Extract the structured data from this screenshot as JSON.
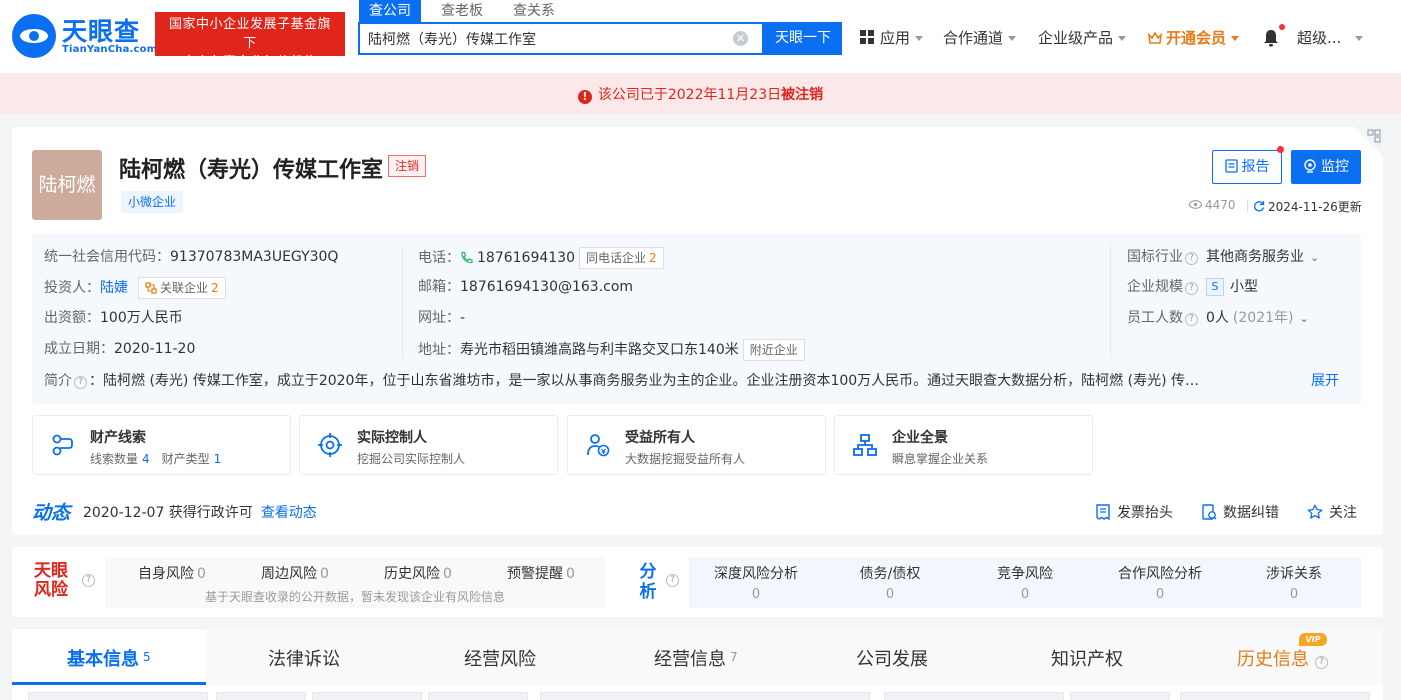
{
  "header": {
    "logo_text": "天眼查",
    "logo_sub": "TianYanCha.com",
    "gov_badge_line1": "国家中小企业发展子基金旗下",
    "gov_badge_line2": "官方备案企业征信机构",
    "search_tabs": [
      "查公司",
      "查老板",
      "查关系"
    ],
    "search_value": "陆柯燃（寿光）传媒工作室",
    "search_button": "天眼一下",
    "nav": {
      "apps": "应用",
      "channels": "合作通道",
      "enterprise": "企业级产品",
      "vip": "开通会员",
      "user": "超级..."
    }
  },
  "notice": {
    "prefix": "该公司已于2022年11月23日",
    "strong": "被注销"
  },
  "company": {
    "avatar_text": "陆柯燃",
    "name": "陆柯燃（寿光）传媒工作室",
    "status": "注销",
    "size_tag": "小微企业",
    "report_label": "报告",
    "monitor_label": "监控",
    "views": "4470",
    "updated": "2024-11-26更新"
  },
  "info": {
    "credit_code_label": "统一社会信用代码：",
    "credit_code": "91370783MA3UEGY30Q",
    "investor_label": "投资人：",
    "investor": "陆婕",
    "related_label": "关联企业",
    "related_count": "2",
    "capital_label": "出资额：",
    "capital": "100万人民币",
    "founded_label": "成立日期：",
    "founded": "2020-11-20",
    "phone_label": "电话：",
    "phone": "18761694130",
    "same_phone_label": "同电话企业",
    "same_phone_count": "2",
    "email_label": "邮箱：",
    "email": "18761694130@163.com",
    "website_label": "网址：",
    "website": "-",
    "address_label": "地址：",
    "address": "寿光市稻田镇潍高路与利丰路交叉口东140米",
    "nearby_label": "附近企业",
    "industry_label": "国标行业",
    "industry": "其他商务服务业",
    "scale_label": "企业规模",
    "scale_icon": "S",
    "scale": "小型",
    "staff_label": "员工人数",
    "staff": "0人",
    "staff_year": "(2021年)",
    "intro_label": "简介",
    "intro": "：陆柯燃 (寿光) 传媒工作室，成立于2020年，位于山东省潍坊市，是一家以从事商务服务业为主的企业。企业注册资本100万人民币。通过天眼查大数据分析，陆柯燃 (寿光) 传…",
    "expand": "展开"
  },
  "features": [
    {
      "title": "财产线索",
      "sub1_label": "线索数量",
      "sub1_value": "4",
      "sub2_label": "财产类型",
      "sub2_value": "1"
    },
    {
      "title": "实际控制人",
      "sub": "挖掘公司实际控制人"
    },
    {
      "title": "受益所有人",
      "sub": "大数据挖掘受益所有人"
    },
    {
      "title": "企业全景",
      "sub": "瞬息掌握企业关系"
    }
  ],
  "dynamic": {
    "title": "动态",
    "text": "2020-12-07 获得行政许可",
    "link": "查看动态",
    "actions": [
      "发票抬头",
      "数据纠错",
      "关注"
    ]
  },
  "risk": {
    "logo_line1": "天眼",
    "logo_line2": "风险",
    "items": [
      {
        "label": "自身风险",
        "value": "0"
      },
      {
        "label": "周边风险",
        "value": "0"
      },
      {
        "label": "历史风险",
        "value": "0"
      },
      {
        "label": "预警提醒",
        "value": "0"
      }
    ],
    "note": "基于天眼查收录的公开数据，暂未发现该企业有风险信息"
  },
  "analysis": {
    "logo_line1": "分",
    "logo_line2": "析",
    "items": [
      {
        "label": "深度风险分析",
        "value": "0"
      },
      {
        "label": "债务/债权",
        "value": "0"
      },
      {
        "label": "竞争风险",
        "value": "0"
      },
      {
        "label": "合作风险分析",
        "value": "0"
      },
      {
        "label": "涉诉关系",
        "value": "0"
      }
    ]
  },
  "tabs": [
    {
      "label": "基本信息",
      "count": "5"
    },
    {
      "label": "法律诉讼",
      "count": ""
    },
    {
      "label": "经营风险",
      "count": ""
    },
    {
      "label": "经营信息",
      "count": "7"
    },
    {
      "label": "公司发展",
      "count": ""
    },
    {
      "label": "知识产权",
      "count": ""
    },
    {
      "label": "历史信息",
      "count": ""
    }
  ],
  "vip_badge": "VIP",
  "colors": {
    "brand": "#0a6ff0",
    "danger": "#e0261a",
    "vip": "#e77b15"
  }
}
